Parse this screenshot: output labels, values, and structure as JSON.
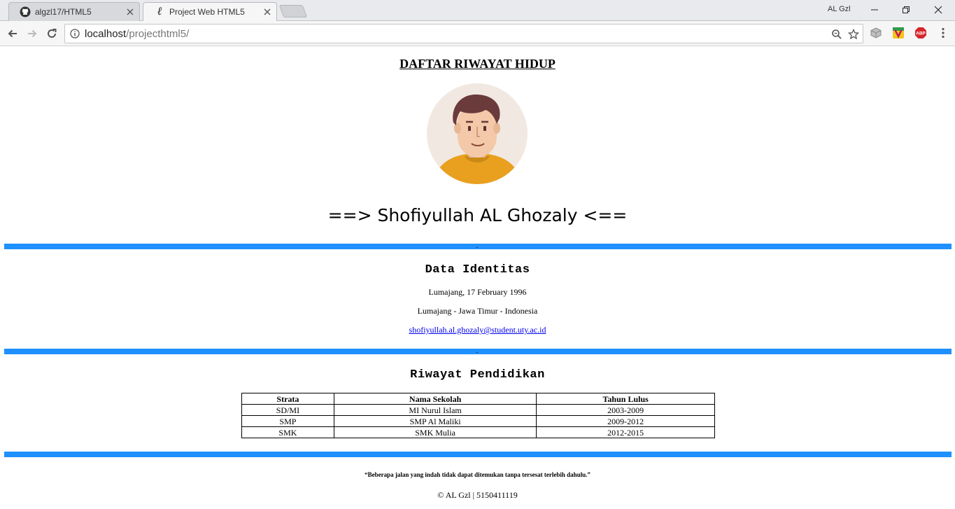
{
  "browser": {
    "tabs": [
      {
        "title": "algzl17/HTML5",
        "icon": "github-icon",
        "active": false
      },
      {
        "title": "Project Web HTML5",
        "icon": "script-l-icon",
        "active": true
      }
    ],
    "profile_name": "AL Gzl",
    "url_host": "localhost",
    "url_path": "/projecthtml5/"
  },
  "page": {
    "title": "DAFTAR RIWAYAT HIDUP",
    "name": "==> Shofiyullah AL Ghozaly <==",
    "identity": {
      "heading": "Data Identitas",
      "birth": "Lumajang, 17 February 1996",
      "address": "Lumajang - Jawa Timur - Indonesia",
      "email": "shofiyullah.al.ghozaly@student.uty.ac.id"
    },
    "education": {
      "heading": "Riwayat Pendidikan",
      "columns": [
        "Strata",
        "Nama Sekolah",
        "Tahun Lulus"
      ],
      "rows": [
        [
          "SD/MI",
          "MI Nurul Islam",
          "2003-2009"
        ],
        [
          "SMP",
          "SMP Al Maliki",
          "2009-2012"
        ],
        [
          "SMK",
          "SMK Mulia",
          "2012-2015"
        ]
      ]
    },
    "quote": "“Beberapa jalan yang indah tidak dapat ditemukan tanpa tersesat terlebih dahulu.”",
    "footer": "© AL Gzl | 5150411119"
  },
  "colors": {
    "divider": "#1e90ff",
    "link": "#0000ee"
  }
}
